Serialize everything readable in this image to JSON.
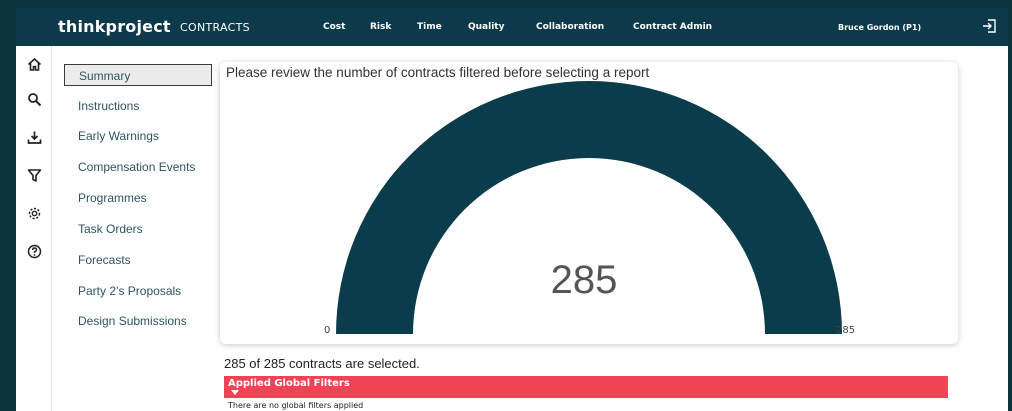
{
  "header": {
    "brand": "thinkproject",
    "product": "CONTRACTS",
    "nav": [
      "Cost",
      "Risk",
      "Time",
      "Quality",
      "Collaboration",
      "Contract Admin"
    ],
    "user": "Bruce Gordon (P1)",
    "logout_icon": "logout-icon"
  },
  "rail": {
    "icons": [
      "home-icon",
      "search-icon",
      "download-icon",
      "filter-icon",
      "settings-icon",
      "help-icon"
    ]
  },
  "menu": {
    "items": [
      "Summary",
      "Instructions",
      "Early Warnings",
      "Compensation Events",
      "Programmes",
      "Task Orders",
      "Forecasts",
      "Party 2’s Proposals",
      "Design Submissions"
    ],
    "active": "Summary"
  },
  "card": {
    "title": "Please review the number of contracts filtered before selecting a report"
  },
  "gauge": {
    "min": "0",
    "max": "285",
    "value": "285",
    "fill_fraction": 1.0,
    "color": "#0b3c4b"
  },
  "summary": {
    "selected_text": "285 of 285 contracts are selected."
  },
  "filters": {
    "title": "Applied Global Filters",
    "empty_text": "There are no global filters applied",
    "color": "#f24356"
  }
}
